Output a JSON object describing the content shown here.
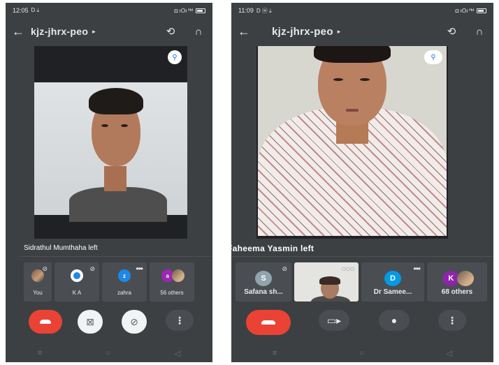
{
  "left_phone": {
    "status": {
      "time": "12:05",
      "left_icons": "D ⤓",
      "right_icons": "◘ ıOı ᴴᵈ"
    },
    "toolbar": {
      "meeting_code": "kjz-jhrx-peo"
    },
    "left_message": "Sidrathul Mumthaha left",
    "participants": [
      {
        "name": "You",
        "initial": "",
        "avatar_color": "#8d6e63",
        "muted": true,
        "more": false
      },
      {
        "name": "K A",
        "initial": "",
        "avatar_color": "#ffffff",
        "muted": true,
        "more": false
      },
      {
        "name": "zahra",
        "initial": "z",
        "avatar_color": "#1e88e5",
        "muted": false,
        "more": true
      },
      {
        "name": "56 others",
        "initial": "a",
        "avatar_color": "#9c27b0",
        "muted": false,
        "more": false
      }
    ],
    "controls": [
      "end-call",
      "camera-off",
      "mic-off",
      "more"
    ]
  },
  "right_phone": {
    "status": {
      "time": "11:09",
      "left_icons": "D ⓦ ⤓",
      "right_icons": "◘ ıOı ᴴᵈ"
    },
    "toolbar": {
      "meeting_code": "kjz-jhrx-peo"
    },
    "left_message": "Faheema Yasmin left",
    "participants": [
      {
        "name": "Safana sh...",
        "initial": "S",
        "avatar_color": "#90a4ae",
        "muted": true,
        "more": false
      },
      {
        "name": "",
        "initial": "",
        "avatar_color": "",
        "muted": false,
        "more": true,
        "self_view": true
      },
      {
        "name": "Dr Samee...",
        "initial": "D",
        "avatar_color": "#039be5",
        "muted": false,
        "more": true
      },
      {
        "name": "68 others",
        "initial": "K",
        "avatar_color": "#8e24aa",
        "muted": false,
        "more": false
      }
    ],
    "controls": [
      "end-call",
      "camera",
      "mic",
      "more"
    ]
  },
  "colors": {
    "background": "#3c4043",
    "end_call": "#ea4335",
    "pin": "#1a73e8"
  },
  "icons": {
    "back": "arrow-left-icon",
    "chevron": "chevron-right-icon",
    "switch_camera": "switch-camera-icon",
    "audio": "headphones-icon",
    "pin": "pin-icon"
  }
}
